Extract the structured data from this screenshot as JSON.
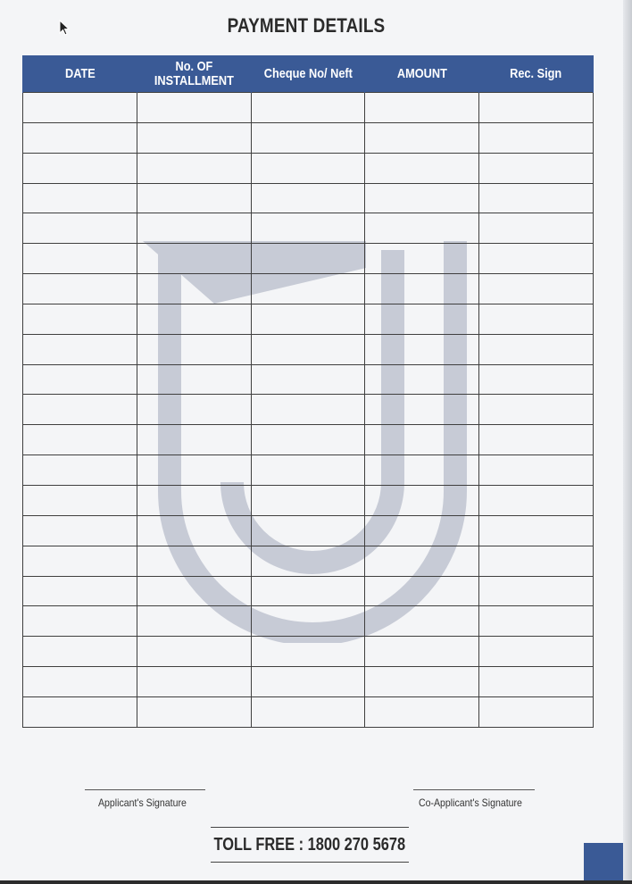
{
  "title": "PAYMENT DETAILS",
  "table": {
    "columns": [
      "DATE",
      "No. OF INSTALLMENT",
      "Cheque No/ Neft",
      "AMOUNT",
      "Rec. Sign"
    ],
    "blank_rows": 21
  },
  "signatures": {
    "applicant": "Applicant's Signature",
    "co_applicant": "Co-Applicant's Signature"
  },
  "toll_free": "TOLL FREE : 1800 270 5678",
  "colors": {
    "header_bg": "#3a5a96",
    "watermark": "#c7cbd6"
  },
  "icons": [
    "mouse-cursor-icon",
    "j-logo-watermark"
  ]
}
